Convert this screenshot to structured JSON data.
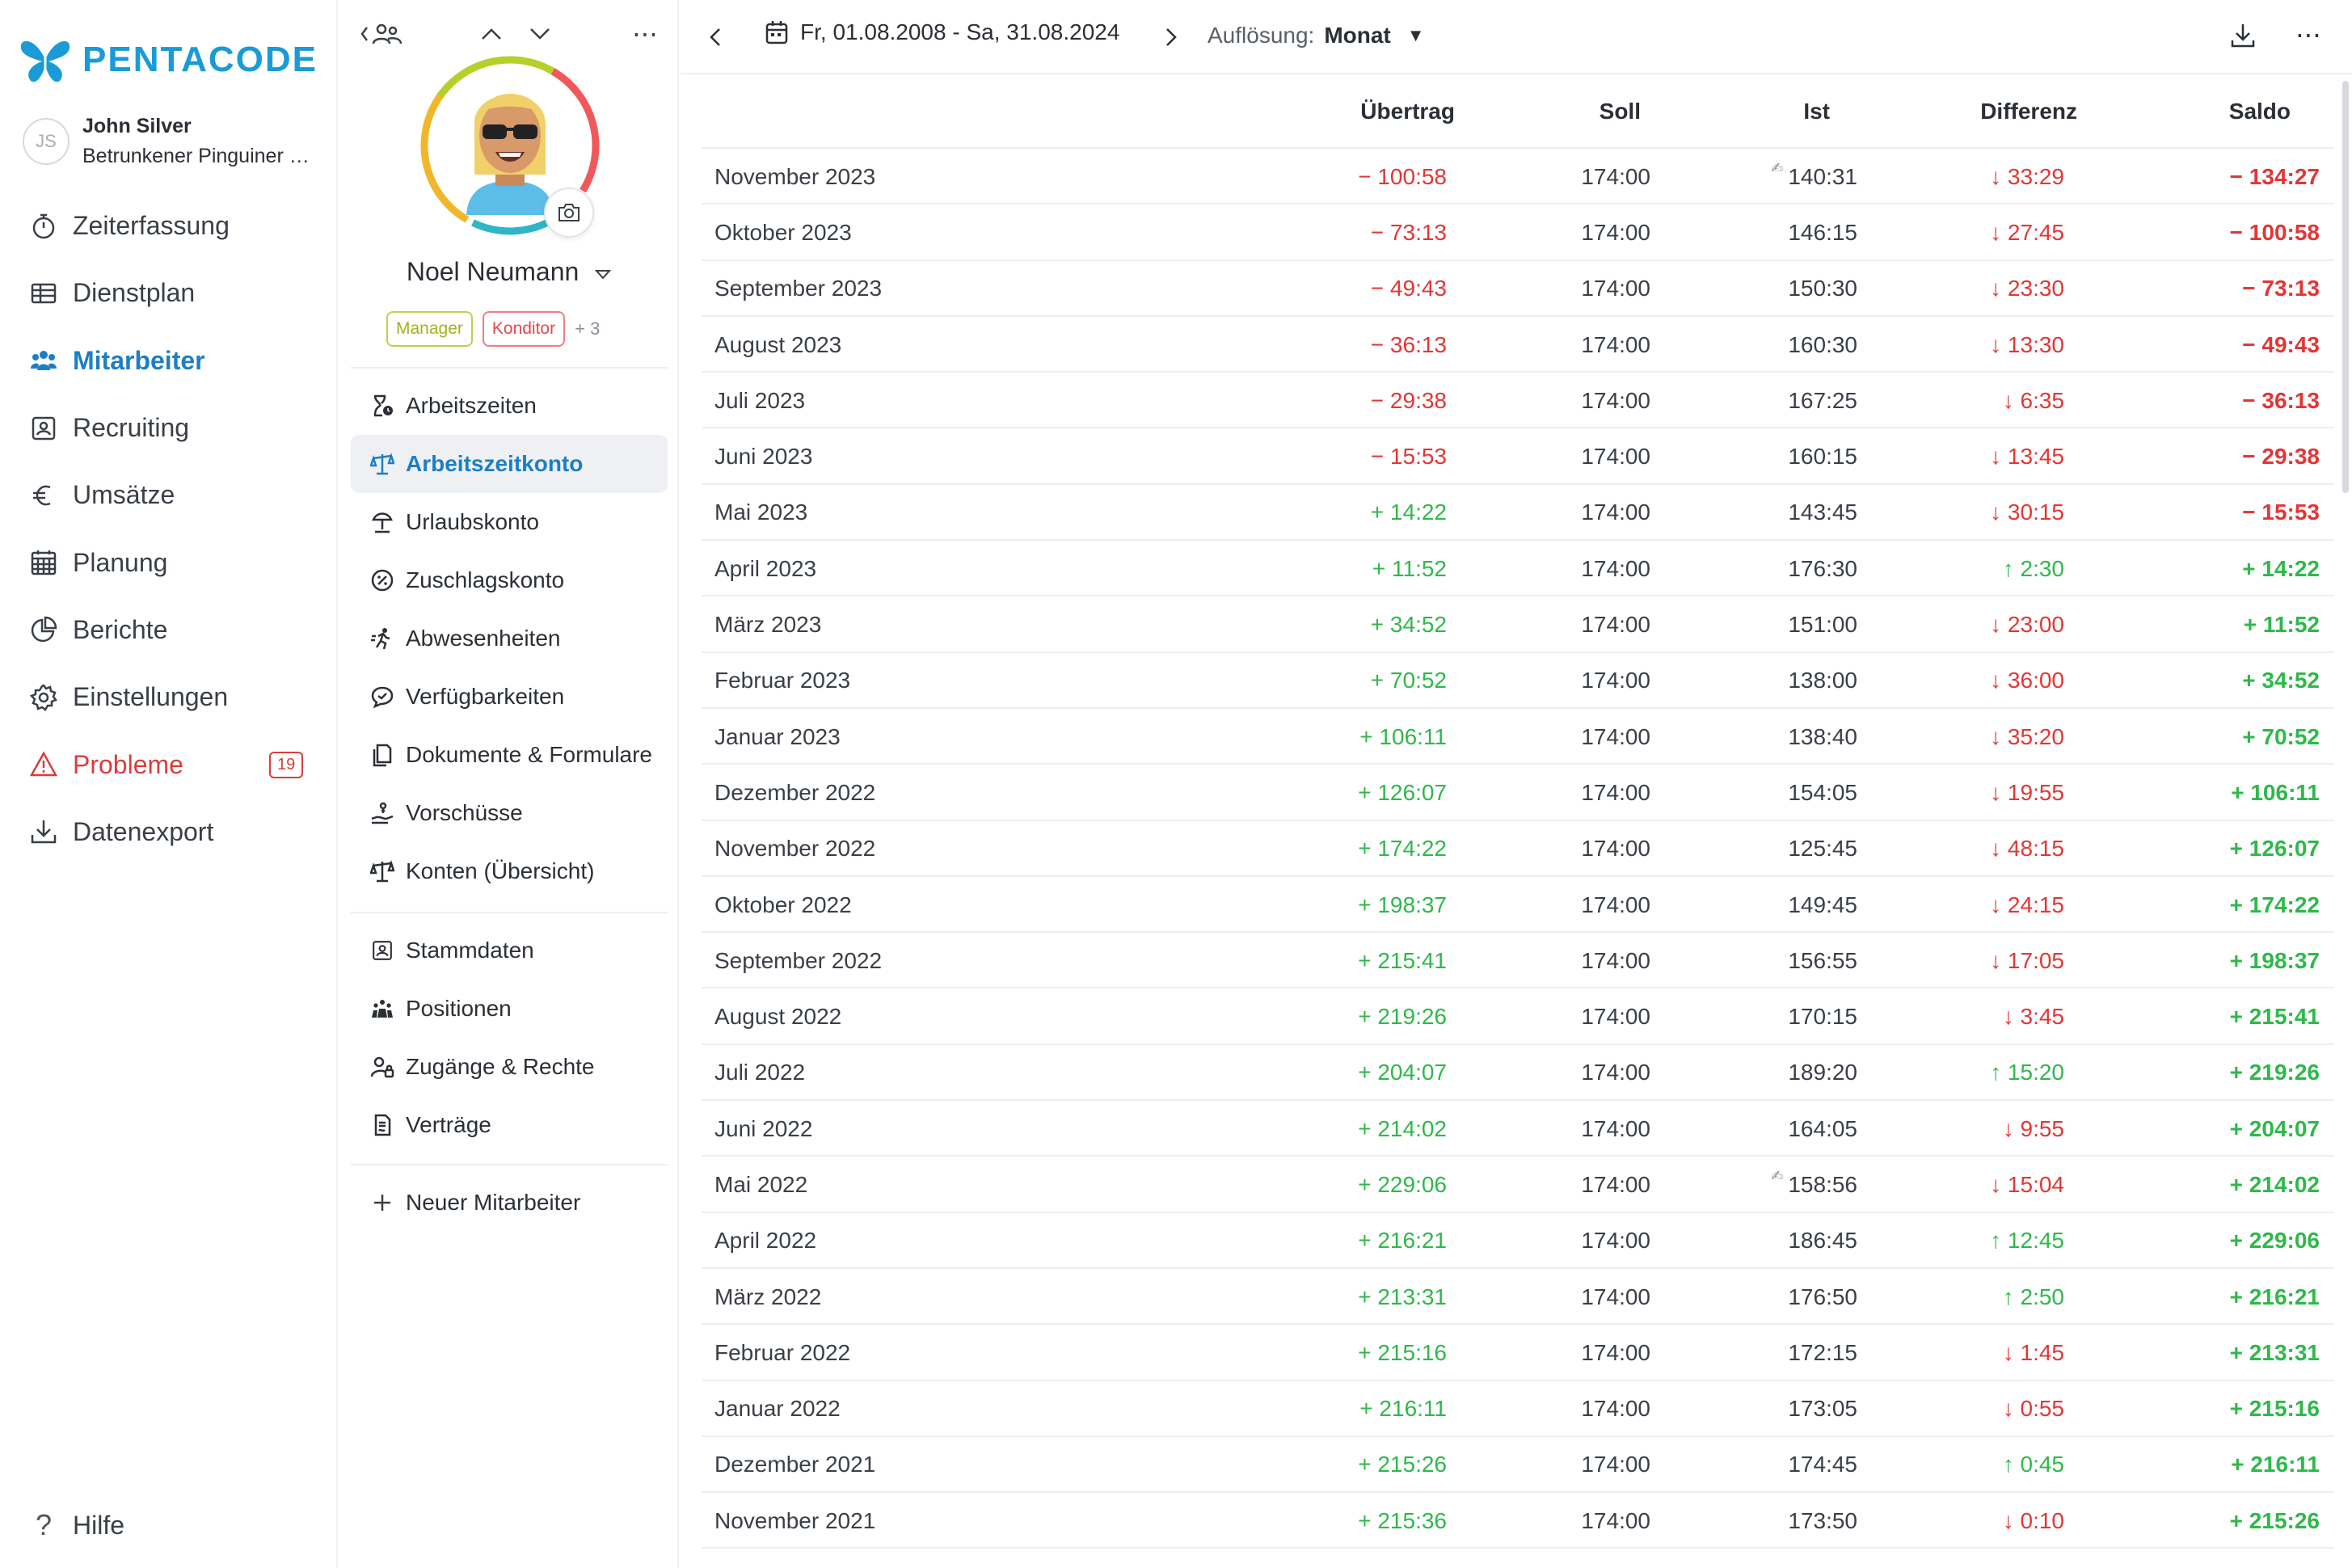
{
  "brand": {
    "name": "PENTACODE",
    "color": "#1a9bd7"
  },
  "user": {
    "initials": "JS",
    "name": "John Silver",
    "company": "Betrunkener Pinguiner Restaurant"
  },
  "nav": {
    "items": [
      {
        "label": "Zeiterfassung",
        "icon": "stopwatch-icon"
      },
      {
        "label": "Dienstplan",
        "icon": "table-icon"
      },
      {
        "label": "Mitarbeiter",
        "icon": "people-icon",
        "active": true
      },
      {
        "label": "Recruiting",
        "icon": "id-card-icon"
      },
      {
        "label": "Umsätze",
        "icon": "euro-icon"
      },
      {
        "label": "Planung",
        "icon": "calendar-grid-icon"
      },
      {
        "label": "Berichte",
        "icon": "pie-chart-icon"
      },
      {
        "label": "Einstellungen",
        "icon": "gear-icon"
      },
      {
        "label": "Probleme",
        "icon": "warning-icon",
        "badge": "19"
      },
      {
        "label": "Datenexport",
        "icon": "download-icon"
      }
    ],
    "help": "Hilfe"
  },
  "employee": {
    "name": "Noel Neumann",
    "tags": [
      "Manager",
      "Konditor"
    ],
    "more_tags": "+ 3",
    "menu_group1": [
      {
        "label": "Arbeitszeiten",
        "icon": "hourglass-clock-icon"
      },
      {
        "label": "Arbeitszeitkonto",
        "icon": "balance-scale-icon",
        "active": true
      },
      {
        "label": "Urlaubskonto",
        "icon": "beach-umbrella-icon"
      },
      {
        "label": "Zuschlagskonto",
        "icon": "percent-clock-icon"
      },
      {
        "label": "Abwesenheiten",
        "icon": "running-person-icon"
      },
      {
        "label": "Verfügbarkeiten",
        "icon": "chat-bubble-icon"
      },
      {
        "label": "Dokumente & Formulare",
        "icon": "documents-icon"
      },
      {
        "label": "Vorschüsse",
        "icon": "hand-coin-icon"
      },
      {
        "label": "Konten (Übersicht)",
        "icon": "balance-scale-icon"
      }
    ],
    "menu_group2": [
      {
        "label": "Stammdaten",
        "icon": "id-card-icon"
      },
      {
        "label": "Positionen",
        "icon": "team-icon"
      },
      {
        "label": "Zugänge & Rechte",
        "icon": "user-lock-icon"
      },
      {
        "label": "Verträge",
        "icon": "contract-icon"
      }
    ],
    "new_employee": "Neuer Mitarbeiter"
  },
  "toolbar": {
    "date_range": "Fr, 01.08.2008 - Sa, 31.08.2024",
    "resolution_label": "Auflösung:",
    "resolution_value": "Monat"
  },
  "table": {
    "columns": [
      "Übertrag",
      "Soll",
      "Ist",
      "Differenz",
      "Saldo"
    ],
    "rows": [
      {
        "month": "November 2023",
        "uebertrag": "− 100:58",
        "u_sign": "neg",
        "soll": "174:00",
        "ist": "140:31",
        "ist_mark": true,
        "diff": "↓ 33:29",
        "d_sign": "neg",
        "saldo": "− 134:27",
        "s_sign": "neg"
      },
      {
        "month": "Oktober 2023",
        "uebertrag": "− 73:13",
        "u_sign": "neg",
        "soll": "174:00",
        "ist": "146:15",
        "diff": "↓ 27:45",
        "d_sign": "neg",
        "saldo": "− 100:58",
        "s_sign": "neg"
      },
      {
        "month": "September 2023",
        "uebertrag": "− 49:43",
        "u_sign": "neg",
        "soll": "174:00",
        "ist": "150:30",
        "diff": "↓ 23:30",
        "d_sign": "neg",
        "saldo": "− 73:13",
        "s_sign": "neg"
      },
      {
        "month": "August 2023",
        "uebertrag": "− 36:13",
        "u_sign": "neg",
        "soll": "174:00",
        "ist": "160:30",
        "diff": "↓ 13:30",
        "d_sign": "neg",
        "saldo": "− 49:43",
        "s_sign": "neg"
      },
      {
        "month": "Juli 2023",
        "uebertrag": "− 29:38",
        "u_sign": "neg",
        "soll": "174:00",
        "ist": "167:25",
        "diff": "↓ 6:35",
        "d_sign": "neg",
        "saldo": "− 36:13",
        "s_sign": "neg"
      },
      {
        "month": "Juni 2023",
        "uebertrag": "− 15:53",
        "u_sign": "neg",
        "soll": "174:00",
        "ist": "160:15",
        "diff": "↓ 13:45",
        "d_sign": "neg",
        "saldo": "− 29:38",
        "s_sign": "neg"
      },
      {
        "month": "Mai 2023",
        "uebertrag": "+ 14:22",
        "u_sign": "pos",
        "soll": "174:00",
        "ist": "143:45",
        "diff": "↓ 30:15",
        "d_sign": "neg",
        "saldo": "− 15:53",
        "s_sign": "neg"
      },
      {
        "month": "April 2023",
        "uebertrag": "+ 11:52",
        "u_sign": "pos",
        "soll": "174:00",
        "ist": "176:30",
        "diff": "↑ 2:30",
        "d_sign": "pos",
        "saldo": "+ 14:22",
        "s_sign": "pos"
      },
      {
        "month": "März 2023",
        "uebertrag": "+ 34:52",
        "u_sign": "pos",
        "soll": "174:00",
        "ist": "151:00",
        "diff": "↓ 23:00",
        "d_sign": "neg",
        "saldo": "+ 11:52",
        "s_sign": "pos"
      },
      {
        "month": "Februar 2023",
        "uebertrag": "+ 70:52",
        "u_sign": "pos",
        "soll": "174:00",
        "ist": "138:00",
        "diff": "↓ 36:00",
        "d_sign": "neg",
        "saldo": "+ 34:52",
        "s_sign": "pos"
      },
      {
        "month": "Januar 2023",
        "uebertrag": "+ 106:11",
        "u_sign": "pos",
        "soll": "174:00",
        "ist": "138:40",
        "diff": "↓ 35:20",
        "d_sign": "neg",
        "saldo": "+ 70:52",
        "s_sign": "pos"
      },
      {
        "month": "Dezember 2022",
        "uebertrag": "+ 126:07",
        "u_sign": "pos",
        "soll": "174:00",
        "ist": "154:05",
        "diff": "↓ 19:55",
        "d_sign": "neg",
        "saldo": "+ 106:11",
        "s_sign": "pos"
      },
      {
        "month": "November 2022",
        "uebertrag": "+ 174:22",
        "u_sign": "pos",
        "soll": "174:00",
        "ist": "125:45",
        "diff": "↓ 48:15",
        "d_sign": "neg",
        "saldo": "+ 126:07",
        "s_sign": "pos"
      },
      {
        "month": "Oktober 2022",
        "uebertrag": "+ 198:37",
        "u_sign": "pos",
        "soll": "174:00",
        "ist": "149:45",
        "diff": "↓ 24:15",
        "d_sign": "neg",
        "saldo": "+ 174:22",
        "s_sign": "pos"
      },
      {
        "month": "September 2022",
        "uebertrag": "+ 215:41",
        "u_sign": "pos",
        "soll": "174:00",
        "ist": "156:55",
        "diff": "↓ 17:05",
        "d_sign": "neg",
        "saldo": "+ 198:37",
        "s_sign": "pos"
      },
      {
        "month": "August 2022",
        "uebertrag": "+ 219:26",
        "u_sign": "pos",
        "soll": "174:00",
        "ist": "170:15",
        "diff": "↓ 3:45",
        "d_sign": "neg",
        "saldo": "+ 215:41",
        "s_sign": "pos"
      },
      {
        "month": "Juli 2022",
        "uebertrag": "+ 204:07",
        "u_sign": "pos",
        "soll": "174:00",
        "ist": "189:20",
        "diff": "↑ 15:20",
        "d_sign": "pos",
        "saldo": "+ 219:26",
        "s_sign": "pos"
      },
      {
        "month": "Juni 2022",
        "uebertrag": "+ 214:02",
        "u_sign": "pos",
        "soll": "174:00",
        "ist": "164:05",
        "diff": "↓ 9:55",
        "d_sign": "neg",
        "saldo": "+ 204:07",
        "s_sign": "pos"
      },
      {
        "month": "Mai 2022",
        "uebertrag": "+ 229:06",
        "u_sign": "pos",
        "soll": "174:00",
        "ist": "158:56",
        "ist_mark": true,
        "diff": "↓ 15:04",
        "d_sign": "neg",
        "saldo": "+ 214:02",
        "s_sign": "pos"
      },
      {
        "month": "April 2022",
        "uebertrag": "+ 216:21",
        "u_sign": "pos",
        "soll": "174:00",
        "ist": "186:45",
        "diff": "↑ 12:45",
        "d_sign": "pos",
        "saldo": "+ 229:06",
        "s_sign": "pos"
      },
      {
        "month": "März 2022",
        "uebertrag": "+ 213:31",
        "u_sign": "pos",
        "soll": "174:00",
        "ist": "176:50",
        "diff": "↑ 2:50",
        "d_sign": "pos",
        "saldo": "+ 216:21",
        "s_sign": "pos"
      },
      {
        "month": "Februar 2022",
        "uebertrag": "+ 215:16",
        "u_sign": "pos",
        "soll": "174:00",
        "ist": "172:15",
        "diff": "↓ 1:45",
        "d_sign": "neg",
        "saldo": "+ 213:31",
        "s_sign": "pos"
      },
      {
        "month": "Januar 2022",
        "uebertrag": "+ 216:11",
        "u_sign": "pos",
        "soll": "174:00",
        "ist": "173:05",
        "diff": "↓ 0:55",
        "d_sign": "neg",
        "saldo": "+ 215:16",
        "s_sign": "pos"
      },
      {
        "month": "Dezember 2021",
        "uebertrag": "+ 215:26",
        "u_sign": "pos",
        "soll": "174:00",
        "ist": "174:45",
        "diff": "↑ 0:45",
        "d_sign": "pos",
        "saldo": "+ 216:11",
        "s_sign": "pos"
      },
      {
        "month": "November 2021",
        "uebertrag": "+ 215:36",
        "u_sign": "pos",
        "soll": "174:00",
        "ist": "173:50",
        "diff": "↓ 0:10",
        "d_sign": "neg",
        "saldo": "+ 215:26",
        "s_sign": "pos"
      }
    ]
  },
  "colors": {
    "accent": "#1c7fc5",
    "positive": "#2fb84a",
    "negative": "#e23636",
    "problem": "#dc3b3b"
  }
}
